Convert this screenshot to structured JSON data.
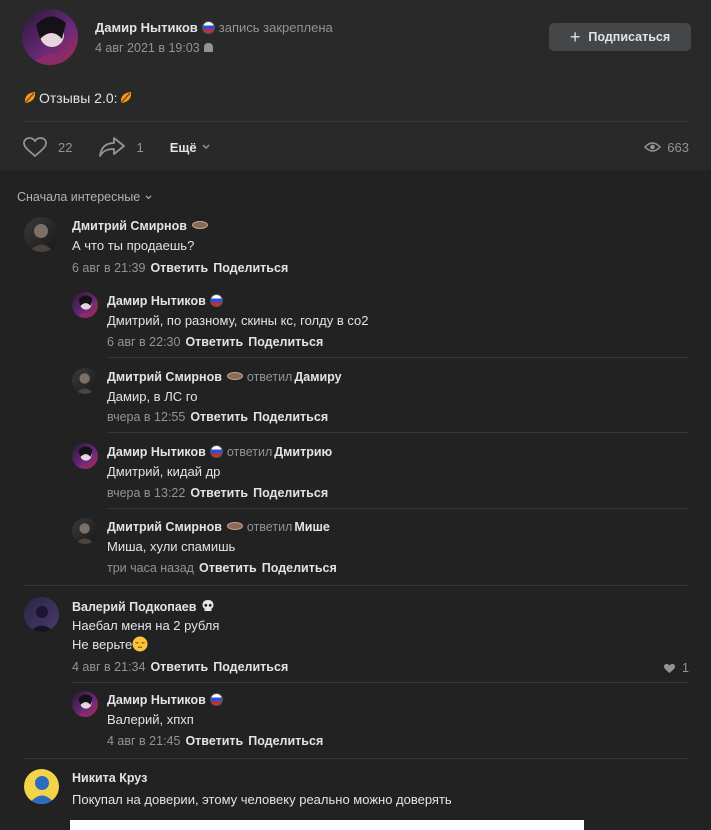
{
  "post": {
    "author": "Дамир Нытиков",
    "pinned_label": "запись закреплена",
    "date": "4 авг 2021 в 19:03",
    "subscribe_label": "Подписаться",
    "text": "Отзывы 2.0:",
    "likes": "22",
    "shares": "1",
    "more_label": "Ещё",
    "views": "663",
    "icons": [
      "heart-icon",
      "share-icon",
      "eye-icon",
      "leaf-icon",
      "android-icon",
      "plus-icon"
    ]
  },
  "sort_label": "Сначала интересные",
  "comments": [
    {
      "name": "Дмитрий Смирнов",
      "text": "А что ты продаешь?",
      "date": "6 авг в 21:39",
      "reply_label": "Ответить",
      "share_label": "Поделиться"
    },
    {
      "name": "Дамир Нытиков",
      "text": "Дмитрий, по разному, скины кс, голду в со2",
      "date": "6 авг в 22:30",
      "reply_label": "Ответить",
      "share_label": "Поделиться"
    },
    {
      "name": "Дмитрий Смирнов",
      "replied": "ответил",
      "target": "Дамиру",
      "text": "Дамир, в ЛС го",
      "date": "вчера в 12:55",
      "reply_label": "Ответить",
      "share_label": "Поделиться"
    },
    {
      "name": "Дамир Нытиков",
      "replied": "ответил",
      "target": "Дмитрию",
      "text": "Дмитрий, кидай др",
      "date": "вчера в 13:22",
      "reply_label": "Ответить",
      "share_label": "Поделиться"
    },
    {
      "name": "Дмитрий Смирнов",
      "replied": "ответил",
      "target": "Мише",
      "text": "Миша, хули спамишь",
      "date": "три часа назад",
      "reply_label": "Ответить",
      "share_label": "Поделиться"
    },
    {
      "name": "Валерий Подкопаев",
      "text": "Наебал меня на 2 рубля",
      "text2": "Не верьте",
      "date": "4 авг в 21:34",
      "reply_label": "Ответить",
      "share_label": "Поделиться",
      "likes": "1"
    },
    {
      "name": "Дамир Нытиков",
      "text": "Валерий, хпхп",
      "date": "4 авг в 21:45",
      "reply_label": "Ответить",
      "share_label": "Поделиться"
    },
    {
      "name": "Никита Круз",
      "text": "Покупал на доверии, этому человеку реально можно доверять"
    }
  ],
  "colors": {
    "background": "#222222",
    "post_bg": "#292929",
    "text": "#e1e3e6",
    "muted": "#939393",
    "button_bg": "#454647"
  }
}
